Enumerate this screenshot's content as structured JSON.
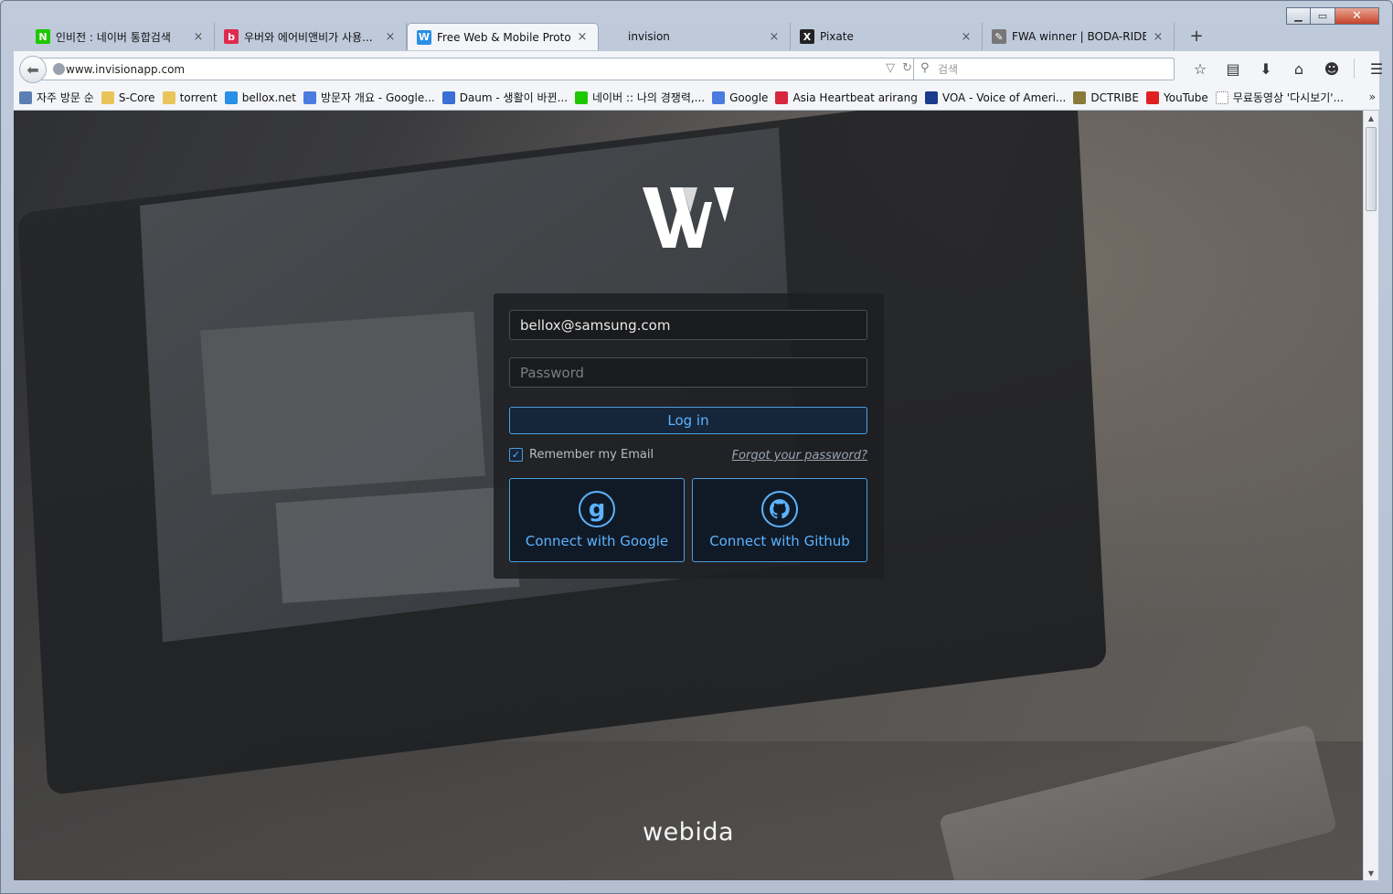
{
  "tabs": [
    {
      "title": "인비전 : 네이버 통합검색",
      "favicon": "naver-icon",
      "color": "#1ec800",
      "glyph": "N",
      "width": 206
    },
    {
      "title": "우버와 에어비앤비가 사용...",
      "favicon": "brunch-icon",
      "color": "#e02b4f",
      "glyph": "b",
      "width": 210
    },
    {
      "title": "Free Web & Mobile Proto...",
      "favicon": "invision-icon",
      "color": "#2a8fe6",
      "glyph": "W",
      "width": 210,
      "active": true
    },
    {
      "title": "invision",
      "favicon": "",
      "color": "transparent",
      "glyph": "",
      "width": 210
    },
    {
      "title": "Pixate",
      "favicon": "pixate-icon",
      "color": "#222",
      "glyph": "X",
      "width": 210
    },
    {
      "title": "FWA winner | BODA-RIDE",
      "favicon": "fwa-icon",
      "color": "#777",
      "glyph": "✎",
      "width": 210
    }
  ],
  "tab_close": "×",
  "new_tab": "+",
  "url": "www.invisionapp.com",
  "search_placeholder": "검색",
  "bookmarks": [
    {
      "label": "자주 방문 순",
      "icon": "most-visited-icon",
      "color": "#5b7fb3"
    },
    {
      "label": "S-Core",
      "icon": "folder-icon",
      "color": "#e9c45a"
    },
    {
      "label": "torrent",
      "icon": "folder-icon",
      "color": "#e9c45a"
    },
    {
      "label": "bellox.net",
      "icon": "bellox-icon",
      "color": "#2a8fe6"
    },
    {
      "label": "방문자 개요 - Google...",
      "icon": "google-analytics-icon",
      "color": "#4a7ce0"
    },
    {
      "label": "Daum - 생활이 바뀐...",
      "icon": "daum-icon",
      "color": "#3b6fd6"
    },
    {
      "label": "네이버 :: 나의 경쟁력,...",
      "icon": "naver-icon",
      "color": "#1ec800"
    },
    {
      "label": "Google",
      "icon": "google-icon",
      "color": "#4a7ce0"
    },
    {
      "label": "Asia Heartbeat arirang",
      "icon": "arirang-icon",
      "color": "#d8263f"
    },
    {
      "label": "VOA - Voice of Ameri...",
      "icon": "voa-icon",
      "color": "#1a3a8c"
    },
    {
      "label": "DCTRIBE",
      "icon": "dctribe-icon",
      "color": "#8a7a3a"
    },
    {
      "label": "YouTube",
      "icon": "youtube-icon",
      "color": "#e02020"
    },
    {
      "label": "무료동영상 '다시보기'...",
      "icon": "page-icon",
      "color": "#ffffff"
    }
  ],
  "bookmarks_more": "»",
  "login": {
    "email": "bellox@samsung.com",
    "password_placeholder": "Password",
    "login_label": "Log in",
    "remember_label": "Remember my Email",
    "remember_checked": true,
    "forgot_label": "Forgot your password?",
    "google_label": "Connect with Google",
    "github_label": "Connect with Github"
  },
  "brand": "webida",
  "colors": {
    "accent": "#5cb3ff",
    "panel": "#1e1f22"
  }
}
